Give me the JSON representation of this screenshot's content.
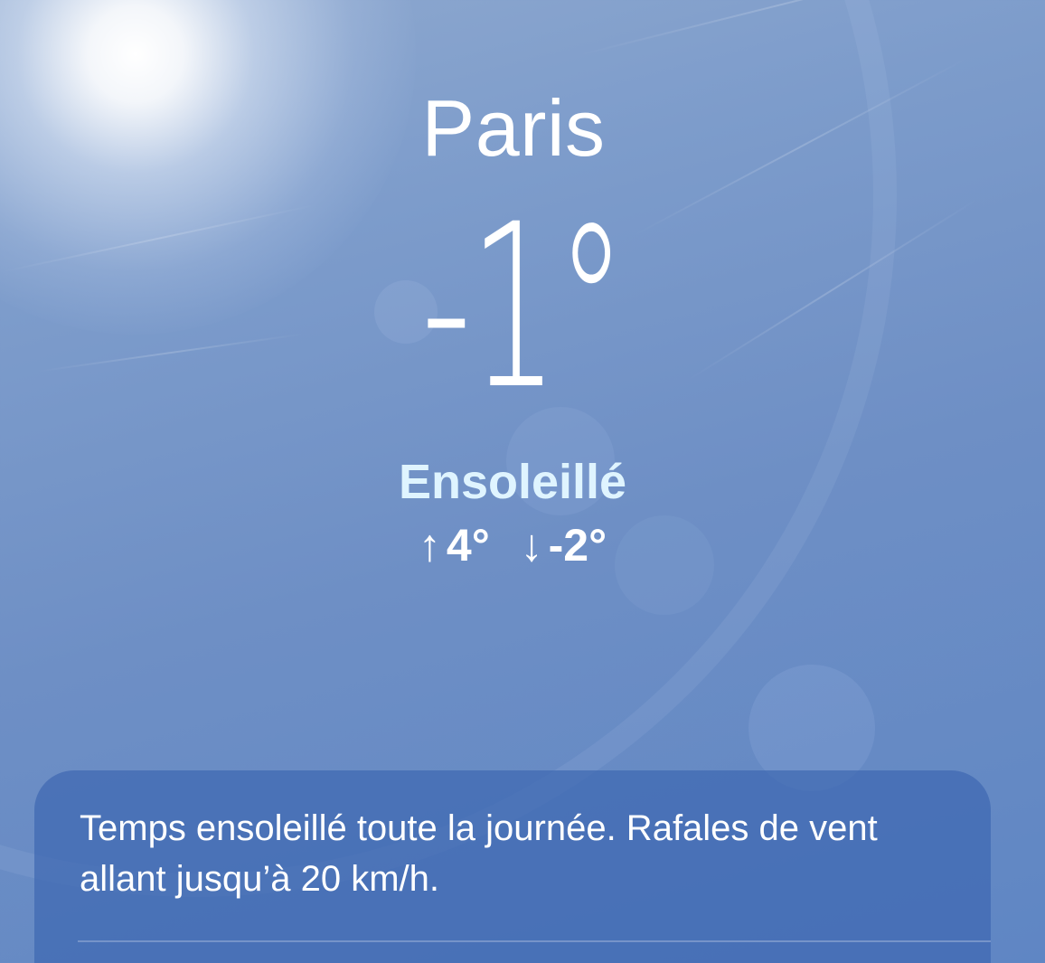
{
  "weather": {
    "city": "Paris",
    "temperature": "-1°",
    "condition": "Ensoleillé",
    "high": "4°",
    "low": "-2°",
    "high_arrow": "↑",
    "low_arrow": "↓"
  },
  "summary_card": {
    "text": "Temps ensoleillé toute la journée. Rafales de vent allant jusqu’à 20 km/h."
  },
  "colors": {
    "sky_top": "#8fa9cf",
    "sky_bottom": "#5f86c4",
    "condition_text": "#dff4ff",
    "card_background": "#3e68b2"
  },
  "icons": {
    "high": "arrow-up-icon",
    "low": "arrow-down-icon"
  }
}
